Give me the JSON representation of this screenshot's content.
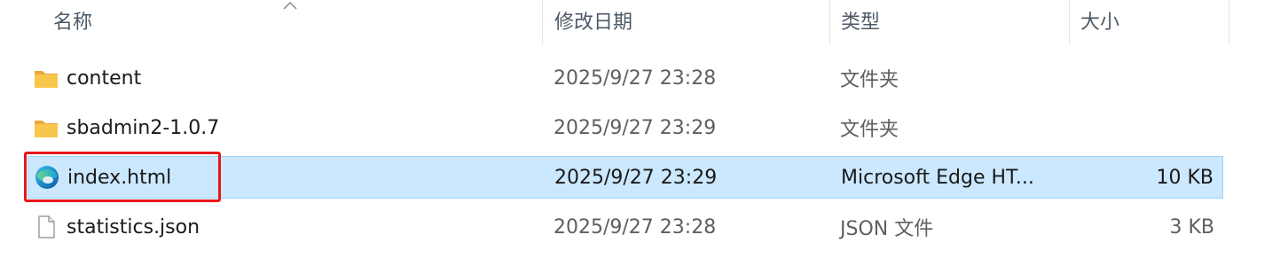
{
  "columns": {
    "name": "名称",
    "date": "修改日期",
    "type": "类型",
    "size": "大小"
  },
  "files": [
    {
      "name": "content",
      "date": "2025/9/27 23:28",
      "type": "文件夹",
      "size": "",
      "icon": "folder-icon"
    },
    {
      "name": "sbadmin2-1.0.7",
      "date": "2025/9/27 23:29",
      "type": "文件夹",
      "size": "",
      "icon": "folder-icon"
    },
    {
      "name": "index.html",
      "date": "2025/9/27 23:29",
      "type": "Microsoft Edge HT...",
      "size": "10 KB",
      "icon": "edge-html-icon",
      "selected": true
    },
    {
      "name": "statistics.json",
      "date": "2025/9/27 23:28",
      "type": "JSON 文件",
      "size": "3 KB",
      "icon": "json-file-icon"
    }
  ],
  "colors": {
    "selection_bg": "#cce8ff",
    "selection_border": "#99d1ff",
    "annotation_box": "#e8161b",
    "folder": "#f8c64a"
  }
}
